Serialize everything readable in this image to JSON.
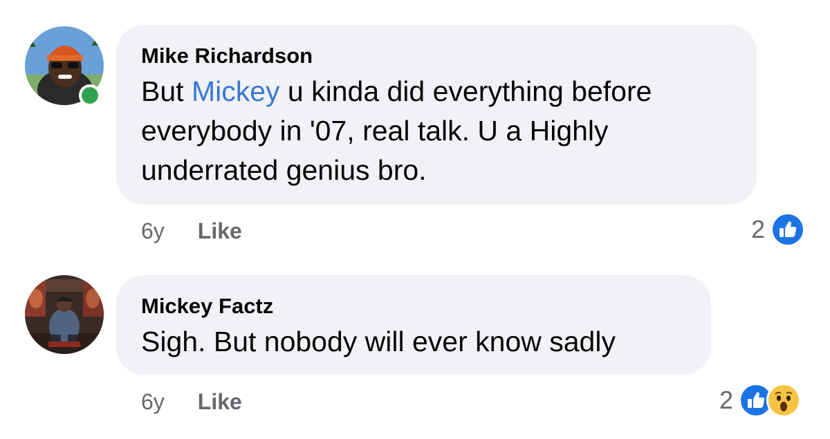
{
  "comments": [
    {
      "author": "Mike Richardson",
      "text_before": "But ",
      "mention": "Mickey",
      "text_after": " u kinda did everything before everybody in '07, real talk. U a Highly underrated genius bro.",
      "time": "6y",
      "like_label": "Like",
      "reaction_count": "2",
      "reactions": [
        "like-icon"
      ],
      "online": true,
      "avatar_icon": "profile-photo-orange-beanie"
    },
    {
      "author": "Mickey Factz",
      "text_before": "Sigh. But nobody will ever know sadly",
      "time": "6y",
      "like_label": "Like",
      "reaction_count": "2",
      "reactions": [
        "like-icon",
        "wow-icon"
      ],
      "online": false,
      "avatar_icon": "profile-photo-seated-figure"
    }
  ],
  "colors": {
    "bubble": "#f0f2f5",
    "mention": "#3a77d2",
    "meta": "#65676b",
    "like_blue": "#1b74e4",
    "online": "#31a24c",
    "wow_yellow": "#f7c442"
  }
}
